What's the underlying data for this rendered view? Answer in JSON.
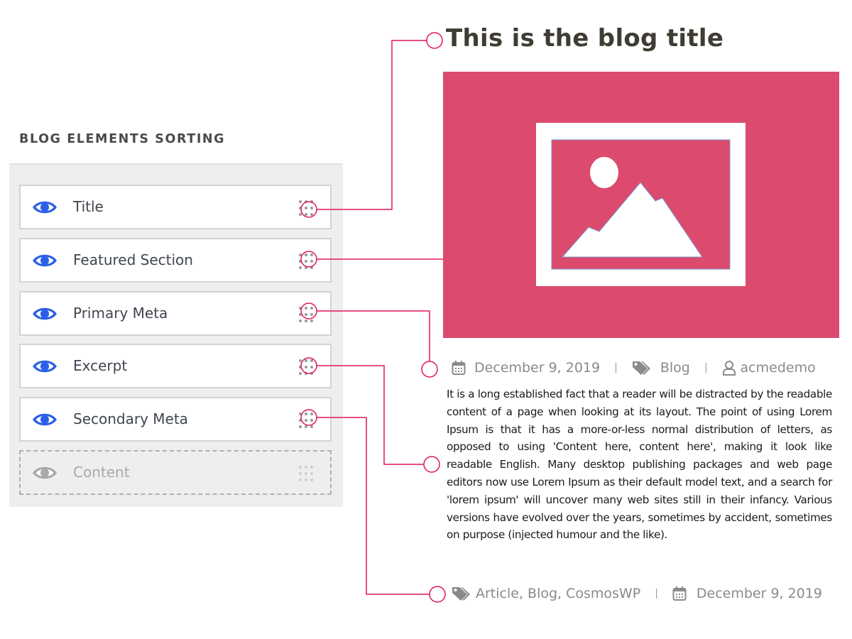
{
  "panel": {
    "heading": "BLOG ELEMENTS SORTING",
    "items": [
      {
        "label": "Title",
        "visible": true
      },
      {
        "label": "Featured Section",
        "visible": true
      },
      {
        "label": "Primary Meta",
        "visible": true
      },
      {
        "label": "Excerpt",
        "visible": true
      },
      {
        "label": "Secondary Meta",
        "visible": true
      },
      {
        "label": "Content",
        "visible": false
      }
    ]
  },
  "preview": {
    "title": "This is the blog title",
    "featured_image_icon": "image-placeholder-icon",
    "primary_meta": {
      "date": "December 9, 2019",
      "separator": "|",
      "category": "Blog",
      "author": "acmedemo"
    },
    "excerpt": "It is a long established fact that a reader will be distracted by the readable content of a page when looking at its layout. The point of using Lorem Ipsum is that it has a more-or-less normal distribution of letters, as opposed to using 'Content here, content here', making it look like readable English. Many desktop publishing packages and web page editors now use Lorem Ipsum as their default model text, and a search for 'lorem ipsum' will uncover many web sites still in their infancy. Various versions have evolved over the years, sometimes by accident, sometimes on purpose (injected humour and the like).",
    "secondary_meta": {
      "tags": "Article, Blog, CosmosWP",
      "separator": "|",
      "date": "December 9, 2019"
    }
  },
  "colors": {
    "accent": "#e0155f",
    "eye_active": "#2a5fe8",
    "eye_inactive": "#a8a8a8",
    "featured_bg": "#dc4b6d"
  }
}
